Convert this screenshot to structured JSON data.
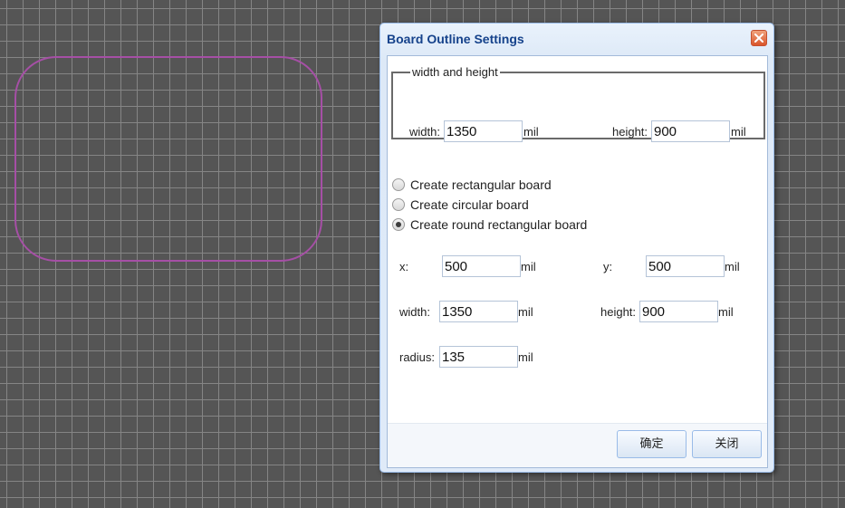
{
  "canvas": {
    "outline_color": "#a64fa6",
    "grid_color": "#858585",
    "background_color": "#555555"
  },
  "dialog": {
    "title": "Board Outline Settings",
    "close_icon": "close-x-icon",
    "close_color": "#d9552a",
    "width_height": {
      "legend": "width and height",
      "width_label": "width:",
      "width_value": "1350",
      "width_unit": "mil",
      "height_label": "height:",
      "height_value": "900",
      "height_unit": "mil"
    },
    "options": [
      {
        "label": "Create rectangular board",
        "checked": false
      },
      {
        "label": "Create circular board",
        "checked": false
      },
      {
        "label": "Create round rectangular board",
        "checked": true
      }
    ],
    "round_rect": {
      "x_label": "x:",
      "x_value": "500",
      "x_unit": "mil",
      "y_label": "y:",
      "y_value": "500",
      "y_unit": "mil",
      "width_label": "width:",
      "width_value": "1350",
      "width_unit": "mil",
      "height_label": "height:",
      "height_value": "900",
      "height_unit": "mil",
      "radius_label": "radius:",
      "radius_value": "135",
      "radius_unit": "mil"
    },
    "ok_label": "确定",
    "close_label": "关闭"
  }
}
